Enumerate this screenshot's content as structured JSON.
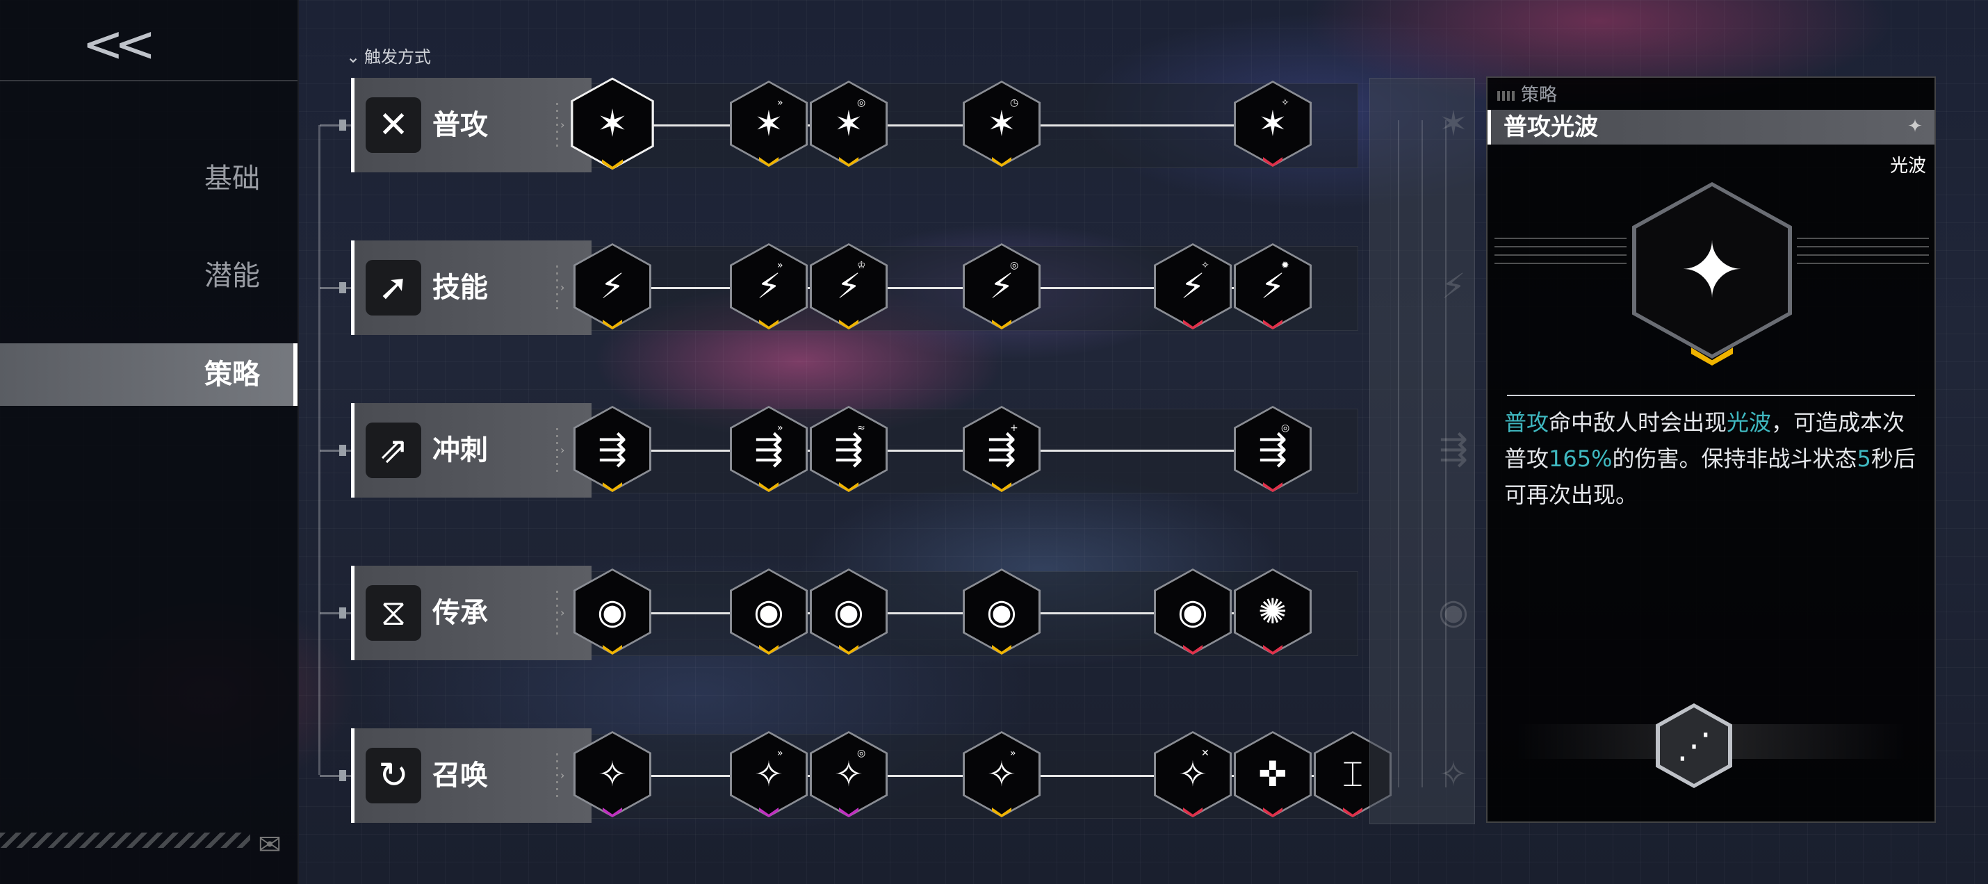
{
  "sidebar": {
    "back_label": "<<",
    "items": [
      {
        "label": "基础",
        "active": false
      },
      {
        "label": "潜能",
        "active": false
      },
      {
        "label": "策略",
        "active": true
      }
    ]
  },
  "header": {
    "label": "触发方式"
  },
  "rows": [
    {
      "label": "普攻",
      "icon": "crossed-swords-icon",
      "glyph": "✕"
    },
    {
      "label": "技能",
      "icon": "arrow-burst-icon",
      "glyph": "➚"
    },
    {
      "label": "冲刺",
      "icon": "dash-runner-icon",
      "glyph": "⇗"
    },
    {
      "label": "传承",
      "icon": "dna-helix-icon",
      "glyph": "⧖"
    },
    {
      "label": "召唤",
      "icon": "summon-circle-icon",
      "glyph": "↻"
    }
  ],
  "colors": {
    "gold": "#f0b400",
    "red": "#e0304a",
    "magenta": "#c030c0",
    "accent_text": "#3fb8c0"
  },
  "detail": {
    "section_title": "策略",
    "name": "普攻光波",
    "tag": "光波",
    "desc_parts": [
      {
        "text": "普攻",
        "hl": true
      },
      {
        "text": "命中敌人时会出现",
        "hl": false
      },
      {
        "text": "光波",
        "hl": true
      },
      {
        "text": "，可造成本次普攻",
        "hl": false
      },
      {
        "text": "165%",
        "hl": true
      },
      {
        "text": "的伤害。保持非战斗状态",
        "hl": false
      },
      {
        "text": "5",
        "hl": true
      },
      {
        "text": "秒后可再次出现。",
        "hl": false
      }
    ]
  }
}
